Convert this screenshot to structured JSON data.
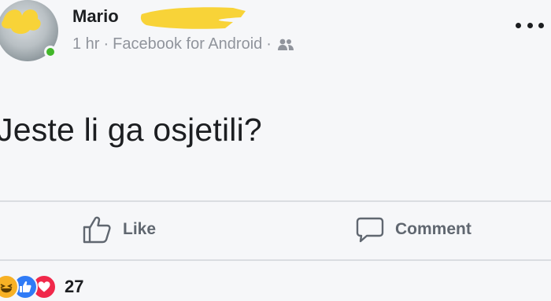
{
  "post": {
    "author": "Mario",
    "time": "1 hr",
    "separator": "·",
    "source": "Facebook for Android",
    "audience_icon": "friends-icon",
    "text": "Jeste li ga osjetili?"
  },
  "actions": {
    "like_label": "Like",
    "like_icon": "thumbs-up-icon",
    "comment_label": "Comment",
    "comment_icon": "comment-bubble-icon"
  },
  "reactions": {
    "types": [
      "haha",
      "like",
      "love"
    ],
    "count": "27"
  },
  "colors": {
    "online": "#42b72a",
    "redaction": "#f8d338",
    "like_reaction": "#2f7bf6",
    "love_reaction": "#f0284a",
    "haha_reaction": "#f7b125",
    "muted_text": "#90949c"
  }
}
